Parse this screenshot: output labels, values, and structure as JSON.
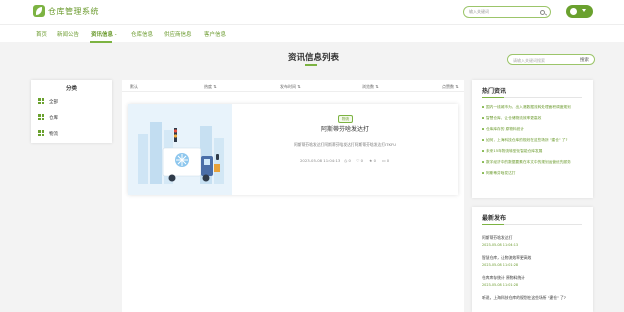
{
  "header": {
    "brand": "仓库管理系统",
    "search_placeholder": "输入关键词"
  },
  "nav": [
    {
      "label": "首页"
    },
    {
      "label": "新闻公告"
    },
    {
      "label": "资讯信息"
    },
    {
      "label": "仓库信息"
    },
    {
      "label": "供应商信息"
    },
    {
      "label": "客户信息"
    }
  ],
  "page": {
    "title": "资讯信息列表",
    "search_placeholder": "请输入关键词搜索",
    "search_button": "搜索"
  },
  "category": {
    "title": "分类",
    "items": [
      {
        "label": "全部"
      },
      {
        "label": "仓库"
      },
      {
        "label": "物流"
      }
    ]
  },
  "filters": [
    {
      "label": "默认"
    },
    {
      "label": "热度 ⇅"
    },
    {
      "label": "发布时间 ⇅"
    },
    {
      "label": "浏览数 ⇅"
    },
    {
      "label": "点赞数 ⇅"
    }
  ],
  "article": {
    "tag": "物流",
    "title": "阿斯蒂芬啥发达打",
    "desc": "阿斯蒂芬啥发达打阿斯蒂芬啥发达打阿斯蒂芬啥发达打ITKFU",
    "date": "2023-05-08 11:04:13",
    "stats": [
      "0",
      "0",
      "0",
      "0"
    ]
  },
  "hot": {
    "title": "热门资讯",
    "items": [
      "国内一线城市为，出入港数据流转处理面积调度规划",
      "智慧仓库，让仓储物流效率更高效",
      "仓库库存的 原物料统计",
      "如何，上海科技仓库的规划在这些场所 \"建仓\" 了?",
      "未来15年物流转型化智能仓库发展",
      "数字经济中的数据要素在本文中的规划运营优先服务",
      "阿斯蒂芬啥发达打"
    ]
  },
  "latest": {
    "title": "最新发布",
    "items": [
      {
        "title": "阿斯蒂芬啥发达打",
        "date": "2023-05-08 11:04:13"
      },
      {
        "title": "智慧仓库，让物流效率更高效",
        "date": "2023-05-08 11:01:28"
      },
      {
        "title": "仓库库存统计 原物料统计",
        "date": "2023-05-08 11:01:28"
      },
      {
        "title": "听说，上海科技仓库的规划在这些场所 \"建仓\" 了?",
        "date": ""
      }
    ]
  },
  "colors": {
    "accent": "#7cb342",
    "accent_text": "#6a9a2c"
  }
}
